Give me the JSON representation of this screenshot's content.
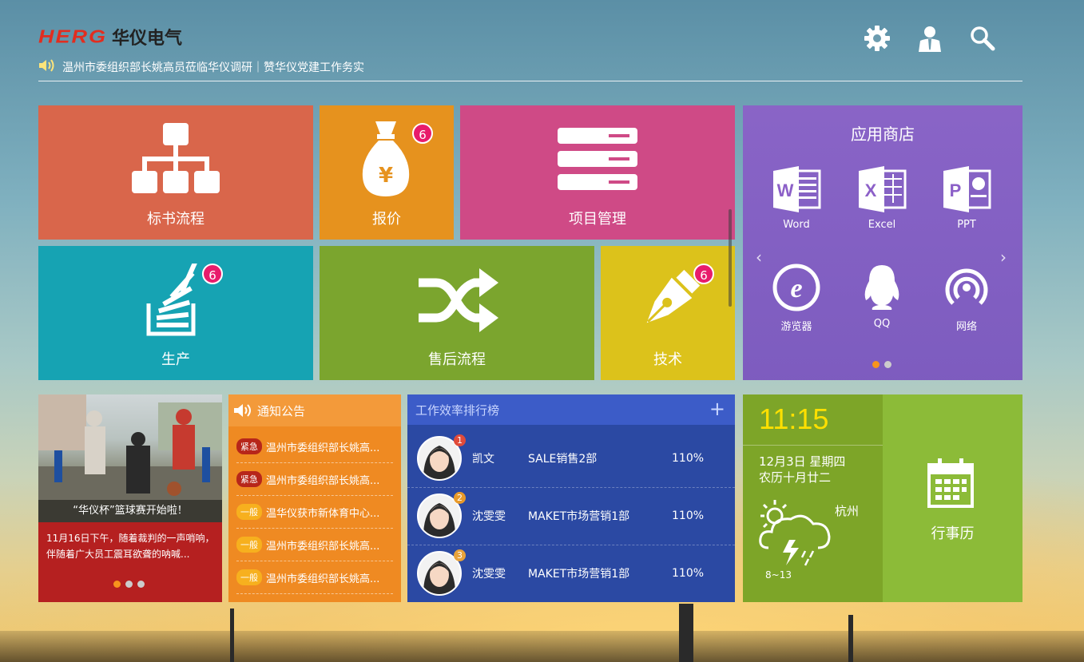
{
  "header": {
    "logo_en": "HERG",
    "logo_cn": "华仪电气",
    "news_text": "温州市委组织部长姚高员莅临华仪调研｜赞华仪党建工作务实",
    "icons": [
      "gear-icon",
      "user-icon",
      "search-icon"
    ]
  },
  "tiles": {
    "bid": {
      "label": "标书流程",
      "color": "#d9664b"
    },
    "quote": {
      "label": "报价",
      "badge": "6",
      "color": "#e6921e"
    },
    "project": {
      "label": "项目管理",
      "color": "#cf4a86"
    },
    "production": {
      "label": "生产",
      "badge": "6",
      "color": "#16a3b3"
    },
    "aftersales": {
      "label": "售后流程",
      "color": "#7ba52e"
    },
    "tech": {
      "label": "技术",
      "badge": "6",
      "color": "#dcc21b"
    }
  },
  "store": {
    "title": "应用商店",
    "apps": [
      {
        "label": "Word",
        "icon": "word-icon"
      },
      {
        "label": "Excel",
        "icon": "excel-icon"
      },
      {
        "label": "PPT",
        "icon": "ppt-icon"
      },
      {
        "label": "游览器",
        "icon": "browser-icon"
      },
      {
        "label": "QQ",
        "icon": "qq-icon"
      },
      {
        "label": "网络",
        "icon": "network-icon"
      }
    ]
  },
  "newscard": {
    "caption": "“华仪杯”篮球赛开始啦！",
    "summary": "11月16日下午，随着裁判的一声哨响，伴随着广大员工震耳欲聋的呐喊..."
  },
  "notice": {
    "title": "通知公告",
    "items": [
      {
        "tag": "紧急",
        "text": "温州市委组织部长姚高..."
      },
      {
        "tag": "紧急",
        "text": "温州市委组织部长姚高..."
      },
      {
        "tag": "一般",
        "text": "温华仪获市新体育中心..."
      },
      {
        "tag": "一般",
        "text": "温州市委组织部长姚高..."
      },
      {
        "tag": "一般",
        "text": "温州市委组织部长姚高..."
      }
    ]
  },
  "ranking": {
    "title": "工作效率排行榜",
    "plus": "+",
    "rows": [
      {
        "rank": "1",
        "name": "凯文",
        "dept": "SALE销售2部",
        "pct": "110%"
      },
      {
        "rank": "2",
        "name": "沈雯雯",
        "dept": "MAKET市场营销1部",
        "pct": "110%"
      },
      {
        "rank": "3",
        "name": "沈雯雯",
        "dept": "MAKET市场营销1部",
        "pct": "110%"
      }
    ]
  },
  "calendar": {
    "time": "11:15",
    "date_line1": "12月3日 星期四",
    "date_line2": "农历十月廿二",
    "city": "杭州",
    "temp": "8~13",
    "label": "行事历"
  }
}
